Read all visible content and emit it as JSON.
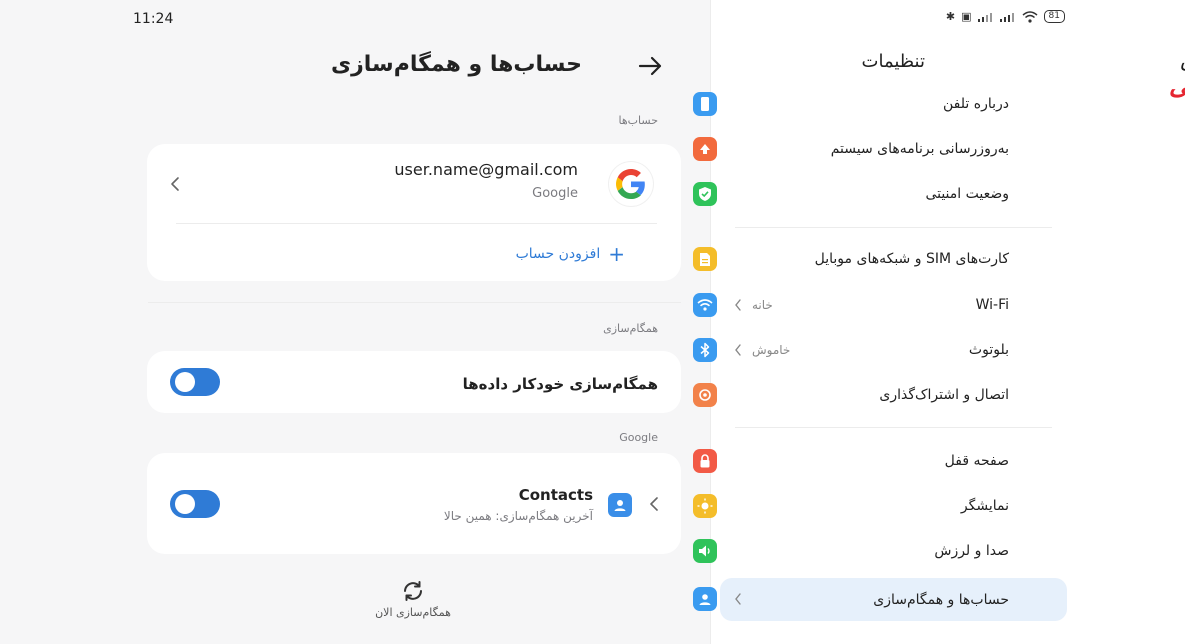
{
  "status_bar": {
    "time": "11:24",
    "battery": "81"
  },
  "accounts_page": {
    "title": "حساب‌ها و همگام‌سازی",
    "accounts_section_label": "حساب‌ها",
    "account": {
      "email": "user.name@gmail.com",
      "provider": "Google"
    },
    "add_account_label": "افزودن حساب",
    "sync_section_label": "همگام‌سازی",
    "auto_sync_label": "همگام‌سازی خودکار داده‌ها",
    "auto_sync_on": true,
    "google_section_label": "Google",
    "contacts": {
      "title": "Contacts",
      "subtitle": "آخرین همگام‌سازی: همین حالا",
      "sync_on": true
    },
    "sync_now_label": "همگام‌سازی الان"
  },
  "settings": {
    "title": "تنظیمات",
    "items": [
      {
        "label": "درباره تلفن",
        "icon": "phone-icon",
        "color": "#3a9bf0"
      },
      {
        "label": "به‌روزرسانی برنامه‌های سیستم",
        "icon": "arrow-up-icon",
        "color": "#f26a3d"
      },
      {
        "label": "وضعیت امنیتی",
        "icon": "shield-check-icon",
        "color": "#2fc35a"
      },
      {
        "label": "کارت‌های SIM و شبکه‌های موبایل",
        "icon": "sim-icon",
        "color": "#f4bd2a"
      },
      {
        "label": "Wi-Fi",
        "icon": "wifi-icon",
        "color": "#3a9bf0",
        "value": "خانه"
      },
      {
        "label": "بلوتوث",
        "icon": "bluetooth-icon",
        "color": "#3a9bf0",
        "value": "خاموش"
      },
      {
        "label": "اتصال و اشتراک‌گذاری",
        "icon": "share-icon",
        "color": "#f2824a"
      },
      {
        "label": "صفحه قفل",
        "icon": "lock-icon",
        "color": "#f25a46"
      },
      {
        "label": "نمایشگر",
        "icon": "sun-icon",
        "color": "#f4bd2a"
      },
      {
        "label": "صدا و لرزش",
        "icon": "speaker-icon",
        "color": "#2fc35a"
      },
      {
        "label": "حساب‌ها و همگام‌سازی",
        "icon": "person-icon",
        "color": "#3a9bf0"
      }
    ]
  },
  "watermark": {
    "text": "گوشی آنلاین"
  }
}
